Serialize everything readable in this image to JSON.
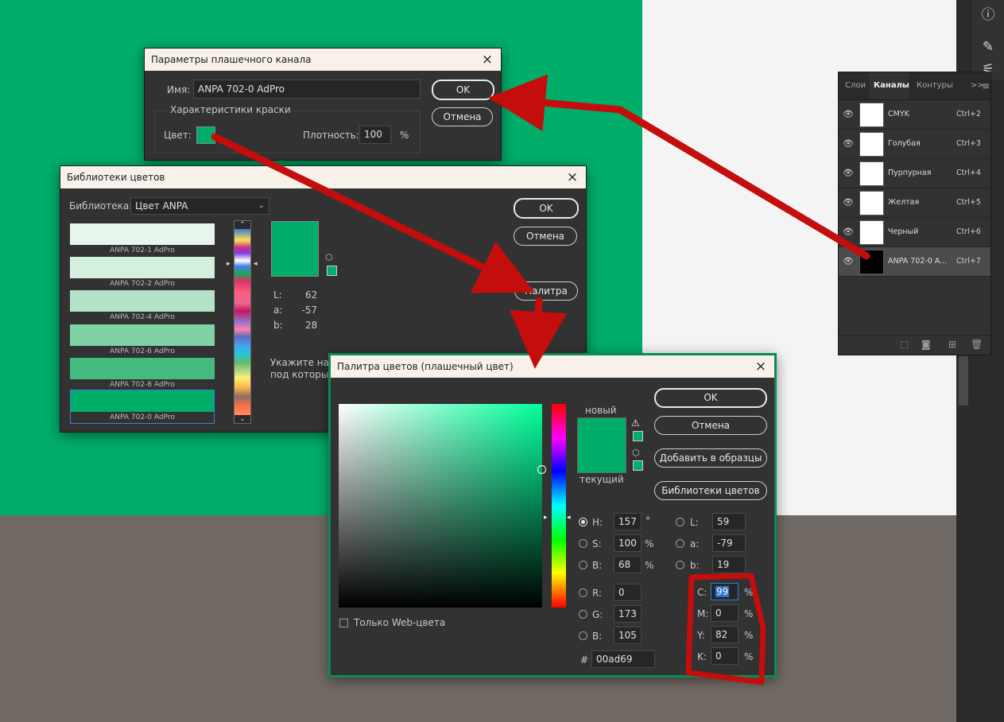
{
  "spot_dialog": {
    "title": "Параметры плашечного канала",
    "name_label": "Имя:",
    "name_value": "ANPA 702-0 AdPro",
    "ok": "OK",
    "cancel": "Отмена",
    "group_label": "Характеристики краски",
    "color_label": "Цвет:",
    "density_label": "Плотность:",
    "density_value": "100",
    "density_unit": "%",
    "close": "×"
  },
  "library_dialog": {
    "title": "Библиотеки цветов",
    "library_label": "Библиотека:",
    "library_value": "Цвет ANPA",
    "ok": "OK",
    "cancel": "Отмена",
    "picker": "Палитра",
    "items": [
      {
        "name": "ANPA 702-1 AdPro",
        "color": "#e6f6ec"
      },
      {
        "name": "ANPA 702-2 AdPro",
        "color": "#d3f0df"
      },
      {
        "name": "ANPA 702-4 AdPro",
        "color": "#b2e3c7"
      },
      {
        "name": "ANPA 702-6 AdPro",
        "color": "#7ed2a4"
      },
      {
        "name": "ANPA 702-8 AdPro",
        "color": "#44bb7e"
      },
      {
        "name": "ANPA 702-0 AdPro",
        "color": "#00ad69"
      }
    ],
    "lab": {
      "L_label": "L:",
      "L": "62",
      "a_label": "a:",
      "a": "-57",
      "b_label": "b:",
      "b": "28"
    },
    "hint_line1": "Укажите наз",
    "hint_line2": "под которым",
    "close": "×"
  },
  "picker_dialog": {
    "title": "Палитра цветов (плашечный цвет)",
    "ok": "OK",
    "cancel": "Отмена",
    "add_swatches": "Добавить в образцы",
    "color_libraries": "Библиотеки цветов",
    "new_label": "новый",
    "current_label": "текущий",
    "web_only": "Только Web-цвета",
    "H_label": "H:",
    "H": "157",
    "H_unit": "°",
    "S_label": "S:",
    "S": "100",
    "S_unit": "%",
    "B_label": "B:",
    "B": "68",
    "B_unit": "%",
    "R_label": "R:",
    "R": "0",
    "G_label": "G:",
    "G": "173",
    "B2_label": "B:",
    "B2": "105",
    "L_label": "L:",
    "L": "59",
    "a_label": "a:",
    "a": "-79",
    "b_label": "b:",
    "b": "19",
    "C_label": "C:",
    "C": "99",
    "C_unit": "%",
    "M_label": "M:",
    "M": "0",
    "M_unit": "%",
    "Y_label": "Y:",
    "Y": "82",
    "Y_unit": "%",
    "K_label": "K:",
    "K": "0",
    "K_unit": "%",
    "hex_label": "#",
    "hex": "00ad69",
    "close": "×"
  },
  "channels_panel": {
    "tabs": [
      "Слои",
      "Каналы",
      "Контуры"
    ],
    "active_tab": "Каналы",
    "menu": ">>",
    "channels": [
      {
        "name": "CMYK",
        "shortcut": "Ctrl+2"
      },
      {
        "name": "Голубая",
        "shortcut": "Ctrl+3"
      },
      {
        "name": "Пурпурная",
        "shortcut": "Ctrl+4"
      },
      {
        "name": "Желтая",
        "shortcut": "Ctrl+5"
      },
      {
        "name": "Черный",
        "shortcut": "Ctrl+6"
      },
      {
        "name": "ANPA 702-0 A...",
        "shortcut": "Ctrl+7"
      }
    ]
  },
  "colors": {
    "spot": "#00ad69",
    "annotation_red": "#c40d0d"
  }
}
